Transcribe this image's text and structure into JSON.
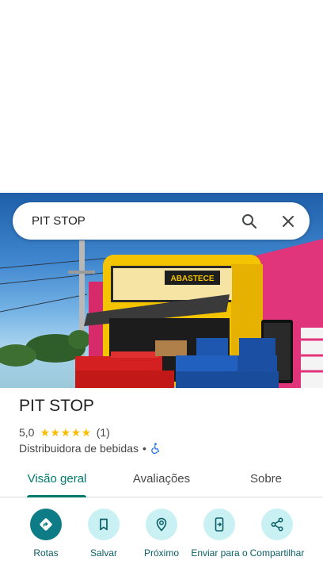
{
  "search": {
    "query": "PIT STOP"
  },
  "hero": {
    "sign_text": "ABASTECE"
  },
  "place": {
    "title": "PIT STOP",
    "rating": "5,0",
    "stars": "★★★★★",
    "review_count": "(1)",
    "category": "Distribuidora de bebidas",
    "separator": "•"
  },
  "tabs": [
    {
      "label": "Visão geral",
      "active": true
    },
    {
      "label": "Avaliações",
      "active": false
    },
    {
      "label": "Sobre",
      "active": false
    }
  ],
  "actions": [
    {
      "label": "Rotas",
      "icon": "directions-icon"
    },
    {
      "label": "Salvar",
      "icon": "bookmark-icon"
    },
    {
      "label": "Próximo",
      "icon": "nearby-icon"
    },
    {
      "label": "Enviar para o",
      "icon": "send-to-phone-icon"
    },
    {
      "label": "Compartilhar",
      "icon": "share-icon"
    }
  ],
  "colors": {
    "accent": "#00796b",
    "action_bg": "#c9f1f4",
    "primary_action": "#0e7c86",
    "stars": "#fbbc04"
  }
}
